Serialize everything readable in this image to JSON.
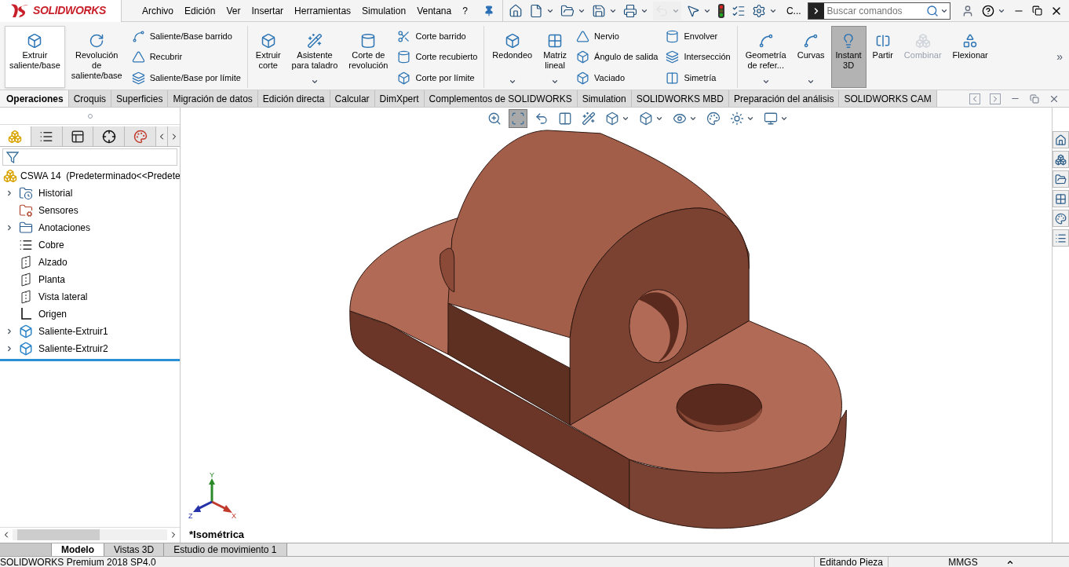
{
  "logo": {
    "text": "SOLIDWORKS"
  },
  "menu": [
    "Archivo",
    "Edición",
    "Ver",
    "Insertar",
    "Herramientas",
    "Simulation",
    "Ventana",
    "?"
  ],
  "quick_access": [
    {
      "kind": "home",
      "dropdown": false,
      "disabled": false
    },
    {
      "kind": "new",
      "dropdown": true,
      "disabled": false
    },
    {
      "kind": "open",
      "dropdown": true,
      "disabled": false
    },
    {
      "kind": "save",
      "dropdown": true,
      "disabled": false
    },
    {
      "kind": "print",
      "dropdown": true,
      "disabled": false
    },
    {
      "kind": "undo",
      "dropdown": true,
      "disabled": true
    },
    {
      "kind": "select",
      "dropdown": true,
      "disabled": false
    },
    {
      "kind": "light",
      "dropdown": false,
      "disabled": false
    },
    {
      "kind": "list",
      "dropdown": false,
      "disabled": false
    },
    {
      "kind": "gear",
      "dropdown": true,
      "disabled": false
    }
  ],
  "quick_access_more": "C...",
  "search": {
    "placeholder": "Buscar comandos"
  },
  "command_groups": [
    {
      "columns": [
        {
          "kind": "large",
          "lines": [
            "Extruir",
            "saliente/base"
          ],
          "dropdown": false,
          "pressed": false,
          "highlighted": true,
          "disabled": false
        },
        {
          "kind": "large",
          "lines": [
            "Revolución",
            "de",
            "saliente/base"
          ],
          "dropdown": false,
          "pressed": false,
          "highlighted": false,
          "disabled": false
        },
        {
          "kind": "stack",
          "items": [
            "Saliente/Base barrido",
            "Recubrir",
            "Saliente/Base por límite"
          ]
        }
      ]
    },
    {
      "columns": [
        {
          "kind": "large",
          "lines": [
            "Extruir",
            "corte"
          ],
          "dropdown": false,
          "pressed": false,
          "highlighted": false,
          "disabled": false
        },
        {
          "kind": "large",
          "lines": [
            "Asistente",
            "para taladro"
          ],
          "dropdown": true,
          "pressed": false,
          "highlighted": false,
          "disabled": false
        },
        {
          "kind": "large",
          "lines": [
            "Corte de",
            "revolución"
          ],
          "dropdown": false,
          "pressed": false,
          "highlighted": false,
          "disabled": false
        },
        {
          "kind": "stack",
          "items": [
            "Corte barrido",
            "Corte recubierto",
            "Corte por límite"
          ]
        }
      ]
    },
    {
      "columns": [
        {
          "kind": "large",
          "lines": [
            "Redondeo"
          ],
          "dropdown": true,
          "pressed": false,
          "highlighted": false,
          "disabled": false
        },
        {
          "kind": "large",
          "lines": [
            "Matriz",
            "lineal"
          ],
          "dropdown": true,
          "pressed": false,
          "highlighted": false,
          "disabled": false
        },
        {
          "kind": "stack",
          "items": [
            "Nervio",
            "Ángulo de salida",
            "Vaciado"
          ]
        },
        {
          "kind": "stack",
          "items": [
            "Envolver",
            "Intersección",
            "Simetría"
          ]
        }
      ]
    },
    {
      "columns": [
        {
          "kind": "large",
          "lines": [
            "Geometría",
            "de refer..."
          ],
          "dropdown": true,
          "pressed": false,
          "highlighted": false,
          "disabled": false
        },
        {
          "kind": "large",
          "lines": [
            "Curvas"
          ],
          "dropdown": true,
          "pressed": false,
          "highlighted": false,
          "disabled": false
        },
        {
          "kind": "large",
          "lines": [
            "Instant",
            "3D"
          ],
          "dropdown": false,
          "pressed": true,
          "highlighted": false,
          "disabled": false
        },
        {
          "kind": "large",
          "lines": [
            "Partir"
          ],
          "dropdown": false,
          "pressed": false,
          "highlighted": false,
          "disabled": false
        },
        {
          "kind": "large",
          "lines": [
            "Combinar"
          ],
          "dropdown": false,
          "pressed": false,
          "highlighted": false,
          "disabled": true
        },
        {
          "kind": "large",
          "lines": [
            "Flexionar"
          ],
          "dropdown": false,
          "pressed": false,
          "highlighted": false,
          "disabled": false
        }
      ]
    }
  ],
  "command_overflow": "»",
  "tabs": [
    {
      "label": "Operaciones",
      "selected": true
    },
    {
      "label": "Croquis",
      "selected": false
    },
    {
      "label": "Superficies",
      "selected": false
    },
    {
      "label": "Migración de datos",
      "selected": false
    },
    {
      "label": "Edición directa",
      "selected": false
    },
    {
      "label": "Calcular",
      "selected": false
    },
    {
      "label": "DimXpert",
      "selected": false
    },
    {
      "label": "Complementos de SOLIDWORKS",
      "selected": false
    },
    {
      "label": "Simulation",
      "selected": false
    },
    {
      "label": "SOLIDWORKS MBD",
      "selected": false
    },
    {
      "label": "Preparación del análisis",
      "selected": false
    },
    {
      "label": "SOLIDWORKS CAM",
      "selected": false
    }
  ],
  "panel_tabs": [
    {
      "kind": "tree",
      "selected": true
    },
    {
      "kind": "property",
      "selected": false
    },
    {
      "kind": "config",
      "selected": false
    },
    {
      "kind": "dimension",
      "selected": false
    },
    {
      "kind": "display",
      "selected": false
    }
  ],
  "tree": {
    "root": "CSWA 14  (Predeterminado<<Predete",
    "items": [
      {
        "label": "Historial",
        "kind": "history",
        "has_children": true,
        "expanded": false
      },
      {
        "label": "Sensores",
        "kind": "sensor",
        "has_children": false
      },
      {
        "label": "Anotaciones",
        "kind": "annotation",
        "has_children": true,
        "expanded": false
      },
      {
        "label": "Cobre",
        "kind": "material",
        "has_children": false
      },
      {
        "label": "Alzado",
        "kind": "plane",
        "has_children": false
      },
      {
        "label": "Planta",
        "kind": "plane",
        "has_children": false
      },
      {
        "label": "Vista lateral",
        "kind": "plane",
        "has_children": false
      },
      {
        "label": "Origen",
        "kind": "origin",
        "has_children": false
      },
      {
        "label": "Saliente-Extruir1",
        "kind": "feature",
        "has_children": true,
        "expanded": false
      },
      {
        "label": "Saliente-Extruir2",
        "kind": "feature",
        "has_children": true,
        "expanded": false
      }
    ]
  },
  "heads_up": [
    {
      "kind": "zoom-fit",
      "selected": false,
      "dropdown": false
    },
    {
      "kind": "zoom-area",
      "selected": true,
      "dropdown": false
    },
    {
      "kind": "previous",
      "selected": false,
      "dropdown": false
    },
    {
      "kind": "section",
      "selected": false,
      "dropdown": false
    },
    {
      "kind": "dynamic",
      "selected": false,
      "dropdown": false
    },
    {
      "kind": "orientation",
      "selected": false,
      "dropdown": true
    },
    {
      "kind": "style",
      "selected": false,
      "dropdown": true
    },
    {
      "kind": "hide",
      "selected": false,
      "dropdown": true
    },
    {
      "kind": "appearance",
      "selected": false,
      "dropdown": false
    },
    {
      "kind": "scene",
      "selected": false,
      "dropdown": true
    },
    {
      "kind": "monitor",
      "selected": false,
      "dropdown": true
    }
  ],
  "task_pane": [
    {
      "kind": "home"
    },
    {
      "kind": "parts"
    },
    {
      "kind": "folder"
    },
    {
      "kind": "palette"
    },
    {
      "kind": "appearance"
    },
    {
      "kind": "properties"
    }
  ],
  "viewport": {
    "view_name": "*Isométrica",
    "triad": {
      "x": "X",
      "y": "Y",
      "z": "Z"
    }
  },
  "bottom_tabs": [
    {
      "label": "Modelo",
      "selected": true
    },
    {
      "label": "Vistas 3D",
      "selected": false
    },
    {
      "label": "Estudio de movimiento 1",
      "selected": false
    }
  ],
  "status_bar": {
    "product": "SOLIDWORKS Premium 2018 SP4.0",
    "mode": "Editando Pieza",
    "units": "MMGS"
  }
}
